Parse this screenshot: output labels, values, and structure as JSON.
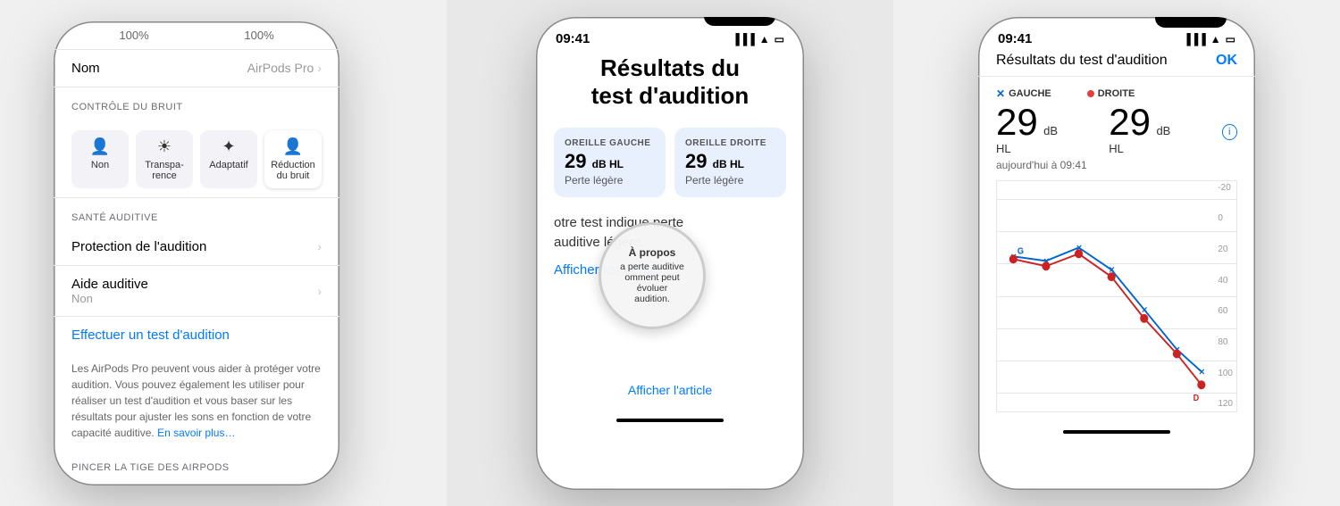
{
  "panel1": {
    "battery_left": "100%",
    "battery_right": "100%",
    "name_label": "Nom",
    "name_value": "AirPods Pro",
    "noise_section": "CONTRÔLE DU BRUIT",
    "noise_options": [
      {
        "id": "non",
        "icon": "👤",
        "label": "Non"
      },
      {
        "id": "transparence",
        "icon": "☀",
        "label": "Transpa-\nrence"
      },
      {
        "id": "adaptatif",
        "icon": "✦",
        "label": "Adaptatif"
      },
      {
        "id": "reduction",
        "icon": "👤",
        "label": "Réduction\ndu bruit"
      }
    ],
    "health_section": "SANTÉ AUDITIVE",
    "items": [
      {
        "label": "Protection de l'audition",
        "subtitle": "",
        "hasChevron": true
      },
      {
        "label": "Aide auditive",
        "subtitle": "Non",
        "hasChevron": true
      }
    ],
    "test_link": "Effectuer un test d'audition",
    "description": "Les AirPods Pro peuvent vous aider à protéger votre audition. Vous pouvez également les utiliser pour réaliser un test d'audition et vous baser sur les résultats pour ajuster les sons en fonction de votre capacité auditive.",
    "en_savoir_link": "En savoir plus…",
    "pincer_section": "PINCER LA TIGE DES AIRPODS"
  },
  "panel2": {
    "time": "09:41",
    "title_line1": "Résultats du",
    "title_line2": "test d'audition",
    "left_ear": {
      "label": "OREILLE GAUCHE",
      "value": "29",
      "unit": "dB HL",
      "desc": "Perte légère"
    },
    "right_ear": {
      "label": "OREILLE DROITE",
      "value": "29",
      "unit": "dB HL",
      "desc": "Perte légère"
    },
    "result_text": "otre test indique perte\nauditive légère.",
    "details_link": "Afficher les détails",
    "magnifier_title": "À propos",
    "magnifier_text": "a perte auditive\nomment peut évoluer\naudition.",
    "article_link": "Afficher l'article"
  },
  "panel3": {
    "time": "09:41",
    "title": "Résultats du test d'audition",
    "ok_btn": "OK",
    "left_label": "GAUCHE",
    "right_label": "DROITE",
    "left_value": "29",
    "right_value": "29",
    "unit": "dB HL",
    "date": "aujourd'hui à 09:41",
    "chart_labels": [
      "-20",
      "0",
      "20",
      "40",
      "60",
      "80",
      "100",
      "120"
    ],
    "g_label": "G",
    "d_label": "D"
  }
}
